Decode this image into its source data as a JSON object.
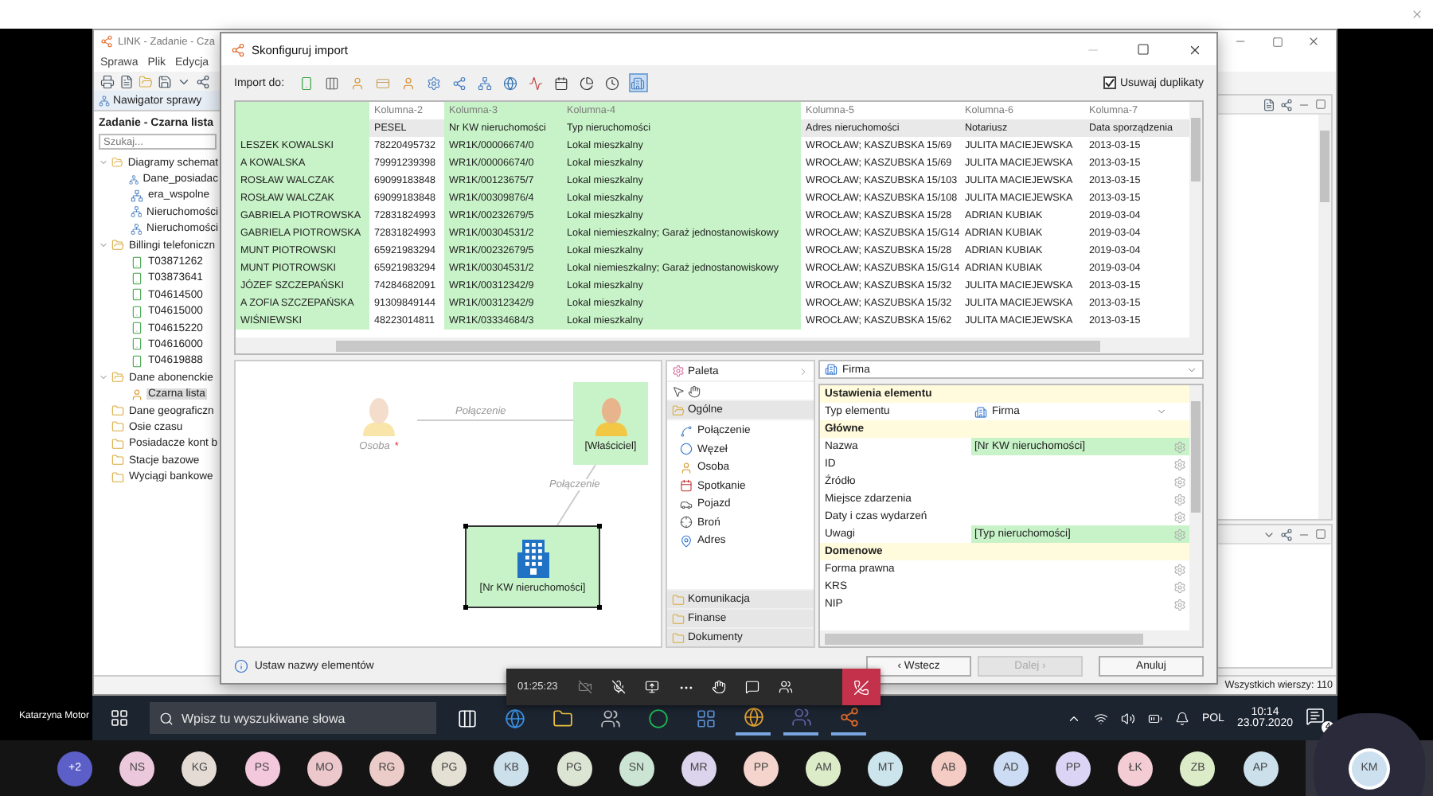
{
  "main_window": {
    "title": "LINK - Zadanie - Cza",
    "menu": [
      "Sprawa",
      "Plik",
      "Edycja"
    ]
  },
  "navigator": {
    "tab": "Nawigator sprawy",
    "heading": "Zadanie - Czarna lista",
    "search": {
      "placeholder": "Szukaj..."
    },
    "tree": [
      {
        "label": "Diagramy schemat",
        "kind": "folder",
        "expanded": true,
        "selected": false,
        "children": [
          {
            "label": "Dane_posiadac",
            "kind": "diagram",
            "selected": false
          },
          {
            "label": "era_wspolne",
            "kind": "diagram",
            "selected": false
          },
          {
            "label": "Nieruchomości",
            "kind": "diagram",
            "selected": false
          },
          {
            "label": "Nieruchomości",
            "kind": "diagram",
            "selected": false
          }
        ]
      },
      {
        "label": "Billingi telefoniczn",
        "kind": "folder",
        "expanded": true,
        "selected": false,
        "children": [
          {
            "label": "T03871262",
            "kind": "phone",
            "selected": false
          },
          {
            "label": "T03873641",
            "kind": "phone",
            "selected": false
          },
          {
            "label": "T04614500",
            "kind": "phone",
            "selected": false
          },
          {
            "label": "T04615000",
            "kind": "phone",
            "selected": false
          },
          {
            "label": "T04615220",
            "kind": "phone",
            "selected": false
          },
          {
            "label": "T04616000",
            "kind": "phone",
            "selected": false
          },
          {
            "label": "T04619888",
            "kind": "phone",
            "selected": false
          }
        ]
      },
      {
        "label": "Dane abonenckie",
        "kind": "folder",
        "expanded": true,
        "selected": false,
        "children": [
          {
            "label": "Czarna lista",
            "kind": "person",
            "selected": true
          }
        ]
      },
      {
        "label": "Dane geograficzn",
        "kind": "folder",
        "selected": false
      },
      {
        "label": "Osie czasu",
        "kind": "folder",
        "selected": false
      },
      {
        "label": "Posiadacze kont b",
        "kind": "folder",
        "selected": false
      },
      {
        "label": "Stacje bazowe",
        "kind": "folder",
        "selected": false
      },
      {
        "label": "Wyciągi bankowe",
        "kind": "folder",
        "selected": false
      }
    ]
  },
  "status_bar": {
    "total_rows": "Wszystkich wierszy: 110"
  },
  "dialog": {
    "title": "Skonfiguruj import",
    "import_label": "Import do:",
    "import_targets": [
      {
        "selected": false
      },
      {
        "selected": false
      },
      {
        "selected": false
      },
      {
        "selected": false
      },
      {
        "selected": false
      },
      {
        "selected": false
      },
      {
        "selected": false
      },
      {
        "selected": false
      },
      {
        "selected": false
      },
      {
        "selected": false
      },
      {
        "selected": false
      },
      {
        "selected": false
      },
      {
        "selected": false
      },
      {
        "selected": true
      }
    ],
    "remove_duplicates": {
      "label": "Usuwaj duplikaty",
      "checked": true
    },
    "table": {
      "columns": [
        {
          "mapped": true
        },
        {
          "title": "Kolumna-2",
          "name": "PESEL",
          "mapped": false
        },
        {
          "title": "Kolumna-3",
          "name": "Nr KW nieruchomości",
          "mapped": true
        },
        {
          "title": "Kolumna-4",
          "name": "Typ nieruchomości",
          "mapped": true
        },
        {
          "title": "Kolumna-5",
          "name": "Adres nieruchomości",
          "mapped": false
        },
        {
          "title": "Kolumna-6",
          "name": "Notariusz",
          "mapped": false
        },
        {
          "title": "Kolumna-7",
          "name": "Data sporządzenia",
          "mapped": false
        }
      ],
      "rows": [
        [
          "LESZEK KOWALSKI",
          "78220495732",
          "WR1K/00006674/0",
          "Lokal mieszkalny",
          "WROCŁAW; KASZUBSKA 15/69",
          "JULITA MACIEJEWSKA",
          "2013-03-15"
        ],
        [
          "A KOWALSKA",
          "79991239398",
          "WR1K/00006674/0",
          "Lokal mieszkalny",
          "WROCŁAW; KASZUBSKA 15/69",
          "JULITA MACIEJEWSKA",
          "2013-03-15"
        ],
        [
          "ROSŁAW WALCZAK",
          "69099183848",
          "WR1K/00123675/7",
          "Lokal mieszkalny",
          "WROCŁAW; KASZUBSKA 15/103",
          "JULITA MACIEJEWSKA",
          "2013-03-15"
        ],
        [
          "ROSŁAW WALCZAK",
          "69099183848",
          "WR1K/00309876/4",
          "Lokal mieszkalny",
          "WROCŁAW; KASZUBSKA 15/108",
          "JULITA MACIEJEWSKA",
          "2013-03-15"
        ],
        [
          "GABRIELA PIOTROWSKA",
          "72831824993",
          "WR1K/00232679/5",
          "Lokal mieszkalny",
          "WROCŁAW; KASZUBSKA 15/28",
          "ADRIAN KUBIAK",
          "2019-03-04"
        ],
        [
          "GABRIELA PIOTROWSKA",
          "72831824993",
          "WR1K/00304531/2",
          "Lokal niemieszkalny; Garaż jednostanowiskowy",
          "WROCŁAW; KASZUBSKA 15/G14",
          "ADRIAN KUBIAK",
          "2019-03-04"
        ],
        [
          "MUNT PIOTROWSKI",
          "65921983294",
          "WR1K/00232679/5",
          "Lokal mieszkalny",
          "WROCŁAW; KASZUBSKA 15/28",
          "ADRIAN KUBIAK",
          "2019-03-04"
        ],
        [
          "MUNT PIOTROWSKI",
          "65921983294",
          "WR1K/00304531/2",
          "Lokal niemieszkalny; Garaż jednostanowiskowy",
          "WROCŁAW; KASZUBSKA 15/G14",
          "ADRIAN KUBIAK",
          "2019-03-04"
        ],
        [
          "JÓZEF SZCZEPAŃSKI",
          "74284682091",
          "WR1K/00312342/9",
          "Lokal mieszkalny",
          "WROCŁAW; KASZUBSKA 15/32",
          "JULITA MACIEJEWSKA",
          "2013-03-15"
        ],
        [
          "A ZOFIA SZCZEPAŃSKA",
          "91309849144",
          "WR1K/00312342/9",
          "Lokal mieszkalny",
          "WROCŁAW; KASZUBSKA 15/32",
          "JULITA MACIEJEWSKA",
          "2013-03-15"
        ],
        [
          "WIŚNIEWSKI",
          "48223014811",
          "WR1K/03334684/3",
          "Lokal mieszkalny",
          "WROCŁAW; KASZUBSKA 15/62",
          "JULITA MACIEJEWSKA",
          "2013-03-15"
        ]
      ]
    },
    "diagram": {
      "nodes": [
        {
          "label": "Osoba",
          "note": "*",
          "kind": "person",
          "mapped": false,
          "selected": false
        },
        {
          "label": "[Właściciel]",
          "kind": "person",
          "mapped": true,
          "selected": false
        },
        {
          "label": "[Nr KW nieruchomości]",
          "kind": "company",
          "mapped": true,
          "selected": true
        }
      ],
      "edges": [
        {
          "label": "Połączenie"
        },
        {
          "label": "Połączenie"
        }
      ]
    },
    "palette": {
      "title": "Paleta",
      "groups": [
        {
          "label": "Ogólne",
          "expanded": true,
          "items": [
            {
              "label": "Połączenie",
              "kind": "link"
            },
            {
              "label": "Węzeł",
              "kind": "node"
            },
            {
              "label": "Osoba",
              "kind": "person"
            },
            {
              "label": "Spotkanie",
              "kind": "meeting"
            },
            {
              "label": "Pojazd",
              "kind": "vehicle"
            },
            {
              "label": "Broń",
              "kind": "weapon"
            },
            {
              "label": "Adres",
              "kind": "address"
            }
          ]
        },
        {
          "label": "Komunikacja",
          "expanded": false
        },
        {
          "label": "Finanse",
          "expanded": false
        },
        {
          "label": "Dokumenty",
          "expanded": false
        }
      ]
    },
    "properties": {
      "element": "Firma",
      "sections": [
        {
          "title": "Ustawienia elementu",
          "rows": [
            {
              "label": "Typ elementu",
              "kind": "dropdown",
              "value": "Firma",
              "mapped": false
            }
          ]
        },
        {
          "title": "Główne",
          "rows": [
            {
              "label": "Nazwa",
              "kind": "field",
              "value": "[Nr KW nieruchomości]",
              "mapped": true
            },
            {
              "label": "ID",
              "kind": "field",
              "mapped": false
            },
            {
              "label": "Źródło",
              "kind": "field",
              "mapped": false
            },
            {
              "label": "Miejsce zdarzenia",
              "kind": "field",
              "mapped": false
            },
            {
              "label": "Daty i czas wydarzeń",
              "kind": "field",
              "mapped": false
            },
            {
              "label": "Uwagi",
              "kind": "field",
              "value": "[Typ nieruchomości]",
              "mapped": true
            }
          ]
        },
        {
          "title": "Domenowe",
          "rows": [
            {
              "label": "Forma prawna",
              "kind": "field",
              "mapped": false
            },
            {
              "label": "KRS",
              "kind": "field",
              "mapped": false
            },
            {
              "label": "NIP",
              "kind": "field",
              "mapped": false
            }
          ]
        }
      ]
    },
    "hint": "Ustaw nazwy elementów",
    "buttons": [
      {
        "label": "‹ Wstecz",
        "disabled": false
      },
      {
        "label": "Dalej ›",
        "disabled": true
      },
      {
        "label": "Anuluj",
        "disabled": false
      }
    ]
  },
  "call_controls": {
    "timer": "01:25:23"
  },
  "video_tile": {
    "name": "Katarzyna Motor"
  },
  "taskbar": {
    "search": {
      "placeholder": "Wpisz tu wyszukiwane słowa"
    },
    "language": "POL",
    "time": "10:14",
    "date": "23.07.2020",
    "notifications": "4"
  },
  "participants": [
    {
      "initials": "+2",
      "color": "#5b5fc7",
      "active": false
    },
    {
      "initials": "NS",
      "color": "#ecc8dc",
      "active": false
    },
    {
      "initials": "KG",
      "color": "#e4dcd4",
      "active": false
    },
    {
      "initials": "PS",
      "color": "#f4c8dc",
      "active": false
    },
    {
      "initials": "MO",
      "color": "#ecc8cc",
      "active": false
    },
    {
      "initials": "RG",
      "color": "#ecccc8",
      "active": false
    },
    {
      "initials": "PG",
      "color": "#e4e0d4",
      "active": false
    },
    {
      "initials": "KB",
      "color": "#cce0ec",
      "active": false
    },
    {
      "initials": "PG",
      "color": "#dce4d4",
      "active": false
    },
    {
      "initials": "SN",
      "color": "#cce4d4",
      "active": false
    },
    {
      "initials": "MR",
      "color": "#dcd4ec",
      "active": false
    },
    {
      "initials": "PP",
      "color": "#f4d4cc",
      "active": false
    },
    {
      "initials": "AM",
      "color": "#dcecc8",
      "active": false
    },
    {
      "initials": "MT",
      "color": "#cce4ec",
      "active": false
    },
    {
      "initials": "AB",
      "color": "#f4ccc4",
      "active": false
    },
    {
      "initials": "AD",
      "color": "#ccdcf4",
      "active": false
    },
    {
      "initials": "PP",
      "color": "#dcd4f4",
      "active": false
    },
    {
      "initials": "ŁK",
      "color": "#f4ccd4",
      "active": false
    },
    {
      "initials": "ZB",
      "color": "#dcecc8",
      "active": false
    },
    {
      "initials": "AP",
      "color": "#cce0ec",
      "active": false
    },
    {
      "initials": "KM",
      "color": "#cce0f0",
      "active": true
    }
  ]
}
